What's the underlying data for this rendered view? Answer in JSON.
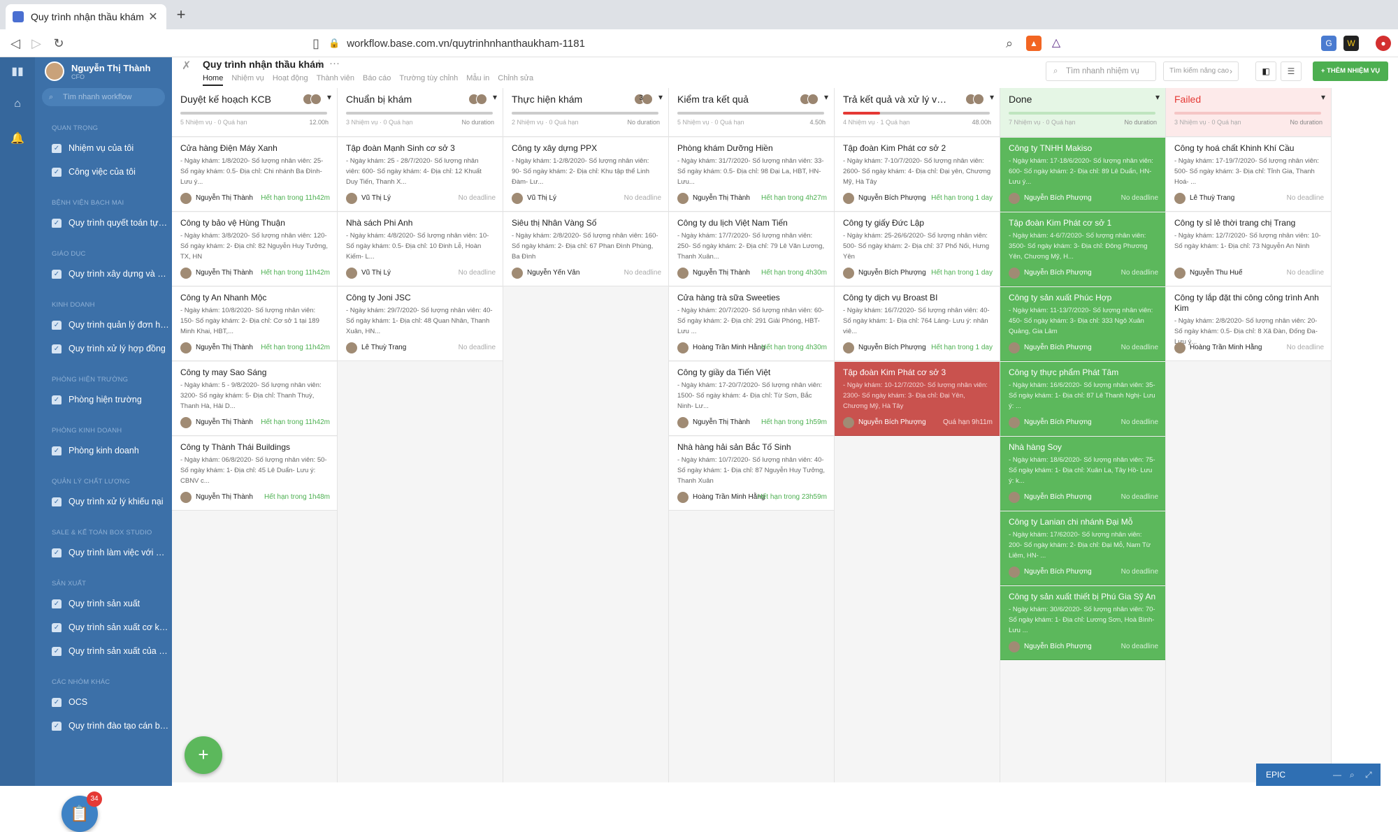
{
  "browser": {
    "tab_title": "Quy trình nhận thầu khám - Quy",
    "url": "workflow.base.com.vn/quytrinhnhanthaukham-1181"
  },
  "sidebar": {
    "user_name": "Nguyễn Thị Thành",
    "user_role": "CFO",
    "search_placeholder": "Tìm nhanh workflow",
    "sections": [
      {
        "title": "QUAN TRỌNG",
        "items": [
          "Nhiệm vụ của tôi",
          "Công việc của tôi"
        ]
      },
      {
        "title": "BỆNH VIỆN BẠCH MAI",
        "items": [
          "Quy trình quyết toán tự c..."
        ]
      },
      {
        "title": "GIÁO DỤC",
        "items": [
          "Quy trình xây dựng và sử..."
        ]
      },
      {
        "title": "KINH DOANH",
        "items": [
          "Quy trình quản lý đơn hàng",
          "Quy trình xử lý hợp đồng"
        ]
      },
      {
        "title": "PHÒNG HIỆN TRƯỜNG",
        "items": [
          "Phòng hiện trường"
        ]
      },
      {
        "title": "PHÒNG KINH DOANH",
        "items": [
          "Phòng kinh doanh"
        ]
      },
      {
        "title": "QUẢN LÝ CHẤT LƯỢNG",
        "items": [
          "Quy trình xử lý khiếu nại"
        ]
      },
      {
        "title": "SALE & KẾ TOÁN BOX STUDIO",
        "items": [
          "Quy trình làm việc với Kh..."
        ]
      },
      {
        "title": "SẢN XUẤT",
        "items": [
          "Quy trình sản xuất",
          "Quy trình sản xuất cơ khí...",
          "Quy trình sản xuất của x..."
        ]
      },
      {
        "title": "CÁC NHÓM KHÁC",
        "items": [
          "OCS",
          "Quy trình đào tạo cán bộ ..."
        ]
      }
    ],
    "badge_count": "34"
  },
  "header": {
    "title": "Quy trình nhận thầu khám",
    "tabs": [
      "Home",
      "Nhiệm vụ",
      "Hoạt động",
      "Thành viên",
      "Báo cáo",
      "Trường tùy chỉnh",
      "Mẫu in",
      "Chỉnh sửa"
    ],
    "active_tab": "Home",
    "quick_search_placeholder": "Tìm nhanh nhiệm vụ",
    "advanced_search": "Tìm kiếm nâng cao",
    "add_task": "+ THÊM NHIỆM VỤ"
  },
  "columns": [
    {
      "name": "Duyệt kế hoạch KCB",
      "count": "",
      "meta": "5 Nhiệm vụ · 0 Quá hạn",
      "duration": "12.00h",
      "style": "normal",
      "progress": 0,
      "cards": [
        {
          "title": "Cửa hàng Điện Máy Xanh",
          "desc": "- Ngày khám: 1/8/2020- Số lượng nhân viên: 25- Số ngày khám: 0.5- Địa chỉ: Chi nhánh Ba Đình- Lưu ý...",
          "who": "Nguyễn Thị Thành",
          "deadline": "Hết hạn trong 11h42m",
          "dl": "g"
        },
        {
          "title": "Công ty bảo vệ Hùng Thuận",
          "desc": "- Ngày khám: 3/8/2020- Số lượng nhân viên: 120- Số ngày khám: 2- Địa chỉ: 82 Nguyễn Huy Tưởng, TX, HN",
          "who": "Nguyễn Thị Thành",
          "deadline": "Hết hạn trong 11h42m",
          "dl": "g"
        },
        {
          "title": "Công ty An Nhanh Mộc",
          "desc": "- Ngày khám: 10/8/2020- Số lượng nhân viên: 150- Số ngày khám: 2- Địa chỉ: Cơ sở 1 tại 189 Minh Khai, HBT,...",
          "who": "Nguyễn Thị Thành",
          "deadline": "Hết hạn trong 11h42m",
          "dl": "g"
        },
        {
          "title": "Công ty may Sao Sáng",
          "desc": "- Ngày khám: 5 - 9/8/2020- Số lượng nhân viên: 3200- Số ngày khám: 5- Địa chỉ: Thanh Thuỳ, Thanh Hà, Hải D...",
          "who": "Nguyễn Thị Thành",
          "deadline": "Hết hạn trong 11h42m",
          "dl": "g"
        },
        {
          "title": "Công ty Thành Thái Buildings",
          "desc": "- Ngày khám: 06/8/2020- Số lượng nhân viên: 50- Số ngày khám: 1- Địa chỉ: 45 Lê Duẩn- Lưu ý: CBNV c...",
          "who": "Nguyễn Thị Thành",
          "deadline": "Hết hạn trong 1h48m",
          "dl": "g"
        }
      ]
    },
    {
      "name": "Chuẩn bị khám",
      "count": "",
      "meta": "3 Nhiệm vụ · 0 Quá hạn",
      "duration": "No duration",
      "style": "normal",
      "progress": 0,
      "cards": [
        {
          "title": "Tập đoàn Mạnh Sinh cơ sở 3",
          "desc": "- Ngày khám: 25 - 28/7/2020- Số lượng nhân viên: 600- Số ngày khám: 4- Địa chỉ: 12 Khuất Duy Tiến, Thanh X...",
          "who": "Vũ Thị Lý",
          "deadline": "No deadline",
          "dl": ""
        },
        {
          "title": "Nhà sách Phi Anh",
          "desc": "- Ngày khám: 4/8/2020- Số lượng nhân viên: 10- Số ngày khám: 0.5- Địa chỉ: 10 Đinh Lễ, Hoàn Kiếm- L...",
          "who": "Vũ Thị Lý",
          "deadline": "No deadline",
          "dl": ""
        },
        {
          "title": "Công ty Joni JSC",
          "desc": "- Ngày khám: 29/7/2020- Số lượng nhân viên: 40- Số ngày khám: 1- Địa chỉ: 48 Quan Nhân, Thanh Xuân, HN...",
          "who": "Lê Thuỳ Trang",
          "deadline": "No deadline",
          "dl": ""
        }
      ]
    },
    {
      "name": "Thực hiện khám",
      "count": "3",
      "meta": "2 Nhiệm vụ · 0 Quá hạn",
      "duration": "No duration",
      "style": "normal",
      "progress": 0,
      "cards": [
        {
          "title": "Công ty xây dựng PPX",
          "desc": "- Ngày khám: 1-2/8/2020- Số lượng nhân viên: 90- Số ngày khám: 2- Địa chỉ: Khu tập thể Linh Đàm- Lư...",
          "who": "Vũ Thị Lý",
          "deadline": "No deadline",
          "dl": ""
        },
        {
          "title": "Siêu thị Nhân Vàng Số",
          "desc": "- Ngày khám: 2/8/2020- Số lượng nhân viên: 160- Số ngày khám: 2- Địa chỉ: 67 Phan Đình Phùng, Ba Đình",
          "who": "Nguyễn Yến Vân",
          "deadline": "No deadline",
          "dl": ""
        }
      ]
    },
    {
      "name": "Kiểm tra kết quả",
      "count": "",
      "meta": "5 Nhiệm vụ · 0 Quá hạn",
      "duration": "4.50h",
      "style": "normal",
      "progress": 0,
      "cards": [
        {
          "title": "Phòng khám Dưỡng Hiền",
          "desc": "- Ngày khám: 31/7/2020- Số lượng nhân viên: 33- Số ngày khám: 0.5- Địa chỉ: 98 Đại La, HBT, HN- Lưu...",
          "who": "Nguyễn Thị Thành",
          "deadline": "Hết hạn trong 4h27m",
          "dl": "g"
        },
        {
          "title": "Công ty du lịch Việt Nam Tiến",
          "desc": "- Ngày khám: 17/7/2020- Số lượng nhân viên: 250- Số ngày khám: 2- Địa chỉ: 79 Lê Văn Lương, Thanh Xuân...",
          "who": "Nguyễn Thị Thành",
          "deadline": "Hết hạn trong 4h30m",
          "dl": "g"
        },
        {
          "title": "Cửa hàng trà sữa Sweeties",
          "desc": "- Ngày khám: 20/7/2020- Số lượng nhân viên: 60- Số ngày khám: 2- Địa chỉ: 291 Giải Phóng, HBT- Lưu ...",
          "who": "Hoàng Trần Minh Hằng",
          "deadline": "Hết hạn trong 4h30m",
          "dl": "g"
        },
        {
          "title": "Công ty giầy da Tiến Việt",
          "desc": "- Ngày khám: 17-20/7/2020- Số lượng nhân viên: 1500- Số ngày khám: 4- Địa chỉ: Từ Sơn, Bắc Ninh- Lư...",
          "who": "Nguyễn Thị Thành",
          "deadline": "Hết hạn trong 1h59m",
          "dl": "g"
        },
        {
          "title": "Nhà hàng hải sản Bắc Tố Sinh",
          "desc": "- Ngày khám: 10/7/2020- Số lượng nhân viên: 40- Số ngày khám: 1- Địa chỉ: 87 Nguyễn Huy Tưởng, Thanh Xuân",
          "who": "Hoàng Trần Minh Hằng",
          "deadline": "Hết hạn trong 23h59m",
          "dl": "g"
        }
      ]
    },
    {
      "name": "Trả kết quả và xử lý vấn đề",
      "count": "",
      "meta": "4 Nhiệm vụ · 1 Quá hạn",
      "duration": "48.00h",
      "style": "normal",
      "progress": 25,
      "cards": [
        {
          "title": "Tập đoàn Kim Phát cơ sở 2",
          "desc": "- Ngày khám: 7-10/7/2020- Số lượng nhân viên: 2600- Số ngày khám: 4- Địa chỉ: Đại yên, Chương Mỹ, Hà Tây",
          "who": "Nguyễn Bích Phượng",
          "deadline": "Hết hạn trong 1 day",
          "dl": "g"
        },
        {
          "title": "Công ty giấy Đức Lập",
          "desc": "- Ngày khám: 25-26/6/2020- Số lượng nhân viên: 500- Số ngày khám: 2- Địa chỉ: 37 Phố Nối, Hưng Yên",
          "who": "Nguyễn Bích Phượng",
          "deadline": "Hết hạn trong 1 day",
          "dl": "g"
        },
        {
          "title": "Công ty dịch vụ Broast BI",
          "desc": "- Ngày khám: 16/7/2020- Số lượng nhân viên: 40- Số ngày khám: 1- Địa chỉ: 764 Láng- Lưu ý: nhân viê...",
          "who": "Nguyễn Bích Phượng",
          "deadline": "Hết hạn trong 1 day",
          "dl": "g"
        },
        {
          "title": "Tập đoàn Kim Phát cơ sở 3",
          "desc": "- Ngày khám: 10-12/7/2020- Số lượng nhân viên: 2300- Số ngày khám: 3- Địa chỉ: Đại Yên, Chương Mỹ, Hà Tây",
          "who": "Nguyễn Bích Phượng",
          "deadline": "Quá hạn 9h11m",
          "dl": "",
          "red": true
        }
      ]
    },
    {
      "name": "Done",
      "count": "",
      "meta": "7 Nhiệm vụ · 0 Quá hạn",
      "duration": "No duration",
      "style": "done",
      "progress": 0,
      "cards": [
        {
          "title": "Công ty TNHH Makiso",
          "desc": "- Ngày khám: 17-18/6/2020- Số lượng nhân viên: 600- Số ngày khám: 2- Địa chỉ: 89 Lê Duẩn, HN- Lưu ý...",
          "who": "Nguyễn Bích Phượng",
          "deadline": "No deadline",
          "dl": ""
        },
        {
          "title": "Tập đoàn Kim Phát cơ sở 1",
          "desc": "- Ngày khám: 4-6/7/2020- Số lượng nhân viên: 3500- Số ngày khám: 3- Địa chỉ: Đông Phương Yên, Chương Mỹ, H...",
          "who": "Nguyễn Bích Phượng",
          "deadline": "No deadline",
          "dl": ""
        },
        {
          "title": "Công ty sản xuất Phúc Hợp",
          "desc": "- Ngày khám: 11-13/7/2020- Số lượng nhân viên: 450- Số ngày khám: 3- Địa chỉ: 333 Ngô Xuân Quảng, Gia Lâm",
          "who": "Nguyễn Bích Phượng",
          "deadline": "No deadline",
          "dl": ""
        },
        {
          "title": "Công ty thực phẩm Phát Tâm",
          "desc": "- Ngày khám: 16/6/2020- Số lượng nhân viên: 35- Số ngày khám: 1- Địa chỉ: 87 Lê Thanh Nghị- Lưu ý: ...",
          "who": "Nguyễn Bích Phượng",
          "deadline": "No deadline",
          "dl": ""
        },
        {
          "title": "Nhà hàng Soy",
          "desc": "- Ngày khám: 18/6/2020- Số lượng nhân viên: 75- Số ngày khám: 1- Địa chỉ: Xuân La, Tây Hồ- Lưu ý: k...",
          "who": "Nguyễn Bích Phượng",
          "deadline": "No deadline",
          "dl": ""
        },
        {
          "title": "Công ty Lanian chi nhánh Đại Mỗ",
          "desc": "- Ngày khám: 17/62020- Số lượng nhân viên: 200- Số ngày khám: 2- Địa chỉ: Đại Mỗ, Nam Từ Liêm, HN- ...",
          "who": "Nguyễn Bích Phượng",
          "deadline": "No deadline",
          "dl": ""
        },
        {
          "title": "Công ty sản xuất thiết bị Phú Gia Sỹ An",
          "desc": "- Ngày khám: 30/6/2020- Số lượng nhân viên: 70- Số ngày khám: 1- Địa chỉ: Lương Sơn, Hoà Bình- Lưu ...",
          "who": "Nguyễn Bích Phượng",
          "deadline": "No deadline",
          "dl": ""
        }
      ]
    },
    {
      "name": "Failed",
      "count": "",
      "meta": "3 Nhiệm vụ · 0 Quá hạn",
      "duration": "No duration",
      "style": "failed",
      "progress": 0,
      "cards": [
        {
          "title": "Công ty hoá chất Khinh Khí Cầu",
          "desc": "- Ngày khám: 17-19/7/2020- Số lượng nhân viên: 500- Số ngày khám: 3- Địa chỉ: Tỉnh Gia, Thanh Hoá- ...",
          "who": "Lê Thuỳ Trang",
          "deadline": "No deadline",
          "dl": ""
        },
        {
          "title": "Công ty sỉ lẻ thời trang chị Trang",
          "desc": "- Ngày khám: 12/7/2020- Số lượng nhân viên: 10- Số ngày khám: 1- Địa chỉ: 73 Nguyễn An Ninh",
          "who": "Nguyễn Thu Huế",
          "deadline": "No deadline",
          "dl": ""
        },
        {
          "title": "Công ty lắp đặt thi công công trình Anh Kim",
          "desc": "- Ngày khám: 2/8/2020- Số lượng nhân viên: 20- Số ngày khám: 0.5- Địa chỉ: 8 Xã Đàn, Đống Đa- Lưu ý...",
          "who": "Hoàng Trần Minh Hằng",
          "deadline": "No deadline",
          "dl": "",
          "two": true
        }
      ]
    }
  ],
  "epic": {
    "label": "EPIC"
  }
}
